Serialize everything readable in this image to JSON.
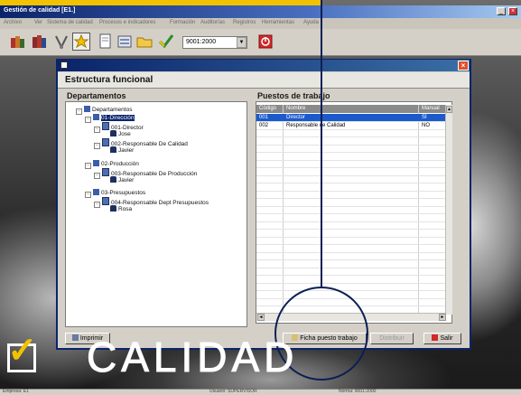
{
  "app": {
    "title": "Gestión de calidad [E1.]",
    "menu": [
      "Archivo",
      "Ver",
      "Sistema de calidad",
      "Procesos e indicadores",
      "Formación",
      "Auditorías",
      "Registros",
      "Herramientas",
      "Ayuda"
    ],
    "toolbar": {
      "standard_select": "9001:2000",
      "icons": [
        "books-icon",
        "books-alt-icon",
        "inspect-icon",
        "star-folder-icon",
        "document-icon",
        "forms-icon",
        "folder-icon",
        "check-icon",
        "exit-icon"
      ]
    }
  },
  "dialog": {
    "heading": "Estructura funcional",
    "tree_title": "Departamentos",
    "tree": [
      {
        "label": "Departamentos",
        "level": 0,
        "icon": "folder-icon"
      },
      {
        "label": "01-Dirección",
        "level": 1,
        "icon": "folder-icon",
        "selected": true
      },
      {
        "label": "001-Director",
        "level": 2,
        "icon": "document-icon"
      },
      {
        "label": "Jose",
        "level": 3,
        "icon": "person-icon"
      },
      {
        "label": "002-Responsable De Calidad",
        "level": 2,
        "icon": "document-icon"
      },
      {
        "label": "Javier",
        "level": 3,
        "icon": "person-icon"
      },
      {
        "label": "02-Producción",
        "level": 1,
        "icon": "folder-icon"
      },
      {
        "label": "003-Responsable De Producción",
        "level": 2,
        "icon": "document-icon"
      },
      {
        "label": "Javier",
        "level": 3,
        "icon": "person-icon"
      },
      {
        "label": "03-Presupuestos",
        "level": 1,
        "icon": "folder-icon"
      },
      {
        "label": "004-Responsable Dept Presupuestos",
        "level": 2,
        "icon": "document-icon"
      },
      {
        "label": "Rosa",
        "level": 3,
        "icon": "person-icon"
      }
    ],
    "grid_title": "Puestos de trabajo",
    "grid_columns": [
      "Código",
      "Nombre",
      "Manual"
    ],
    "grid_rows": [
      {
        "code": "001",
        "name": "Director",
        "manual": "SÍ",
        "selected": true
      },
      {
        "code": "002",
        "name": "Responsable de Calidad",
        "manual": "NO",
        "selected": false
      }
    ],
    "buttons": {
      "print": "Imprimir",
      "job_sheet": "Ficha puesto trabajo",
      "distribute": "Distribuir",
      "exit": "Salir"
    }
  },
  "brand": {
    "logo_text": "CALIDAD"
  },
  "statusbar": [
    "Empresa: E1",
    "Usuario: SUPERVISOR",
    "Norma: 9001:2000"
  ]
}
